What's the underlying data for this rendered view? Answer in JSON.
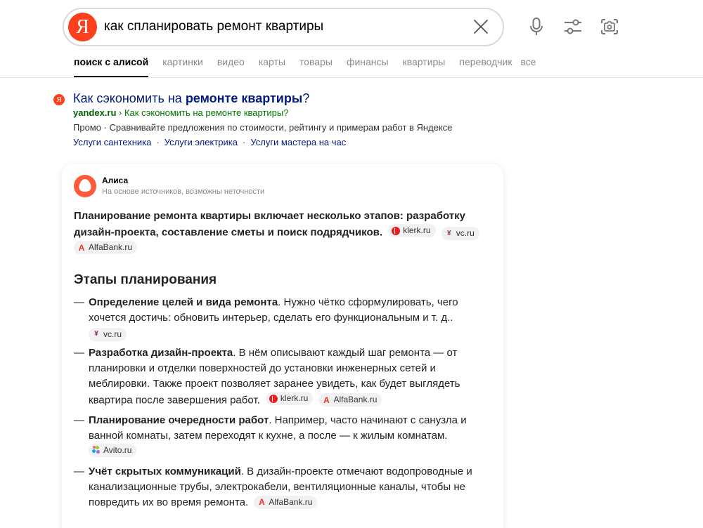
{
  "search": {
    "logo_letter": "Я",
    "query": "как спланировать ремонт квартиры",
    "clear_icon": "close-icon",
    "voice_icon": "microphone-icon",
    "filters_icon": "sliders-icon",
    "camera_icon": "camera-search-icon"
  },
  "tabs": [
    {
      "label": "поиск с алисой",
      "active": true
    },
    {
      "label": "картинки"
    },
    {
      "label": "видео"
    },
    {
      "label": "карты"
    },
    {
      "label": "товары"
    },
    {
      "label": "финансы"
    },
    {
      "label": "квартиры"
    },
    {
      "label": "переводчик"
    },
    {
      "label": "все"
    }
  ],
  "ad": {
    "logo_letter": "Я",
    "title_prefix": "Как сэкономить на ",
    "title_bold": "ремонте квартиры",
    "title_suffix": "?",
    "url_domain": "yandex.ru",
    "url_path": " › Как сэкономить на ремонте квартиры?",
    "description": "Промо · Сравнивайте предложения по стоимости, рейтингу и примерам работ в Яндексе",
    "links": [
      "Услуги сантехника",
      "Услуги электрика",
      "Услуги мастера на час"
    ],
    "links_separator": "·"
  },
  "alice": {
    "name": "Алиса",
    "note": "На основе источников, возможны неточности",
    "summary": "Планирование ремонта квартиры включает несколько этапов: разработку дизайн-проекта, составление сметы и поиск подрядчиков.",
    "section_title": "Этапы планирования",
    "steps": [
      {
        "bold": "Определение целей и вида ремонта",
        "text": ". Нужно чётко сформулировать, чего хочется достичь: обновить интерьер, сделать его функциональным и т. д.."
      },
      {
        "bold": "Разработка дизайн-проекта",
        "text": ". В нём описывают каждый шаг ремонта — от планировки и отделки поверхностей до установки инженерных сетей и меблировки. Также проект позволяет заранее увидеть, как будет выглядеть квартира после завершения работ."
      },
      {
        "bold": "Планирование очередности работ",
        "text": ". Например, часто начинают с санузла и ванной комнаты, затем переходят к кухне, а после — к жилым комнатам."
      },
      {
        "bold": "Учёт скрытых коммуникаций",
        "text": ". В дизайн-проекте отмечают водопроводные и канализационные трубы, электрокабели, вентиляционные каналы, чтобы не повредить их во время ремонта."
      }
    ],
    "dash": "—",
    "sources": {
      "klerk": "klerk.ru",
      "vc": "vc.ru",
      "alfa": "AlfaBank.ru",
      "avito": "Avito.ru"
    },
    "source_glyphs": {
      "vc": "¥",
      "alfa": "А"
    }
  },
  "colors": {
    "brand": "#fc3f1d",
    "link": "#001a80",
    "url_green": "#007700",
    "alice": "#ff5b3a"
  }
}
